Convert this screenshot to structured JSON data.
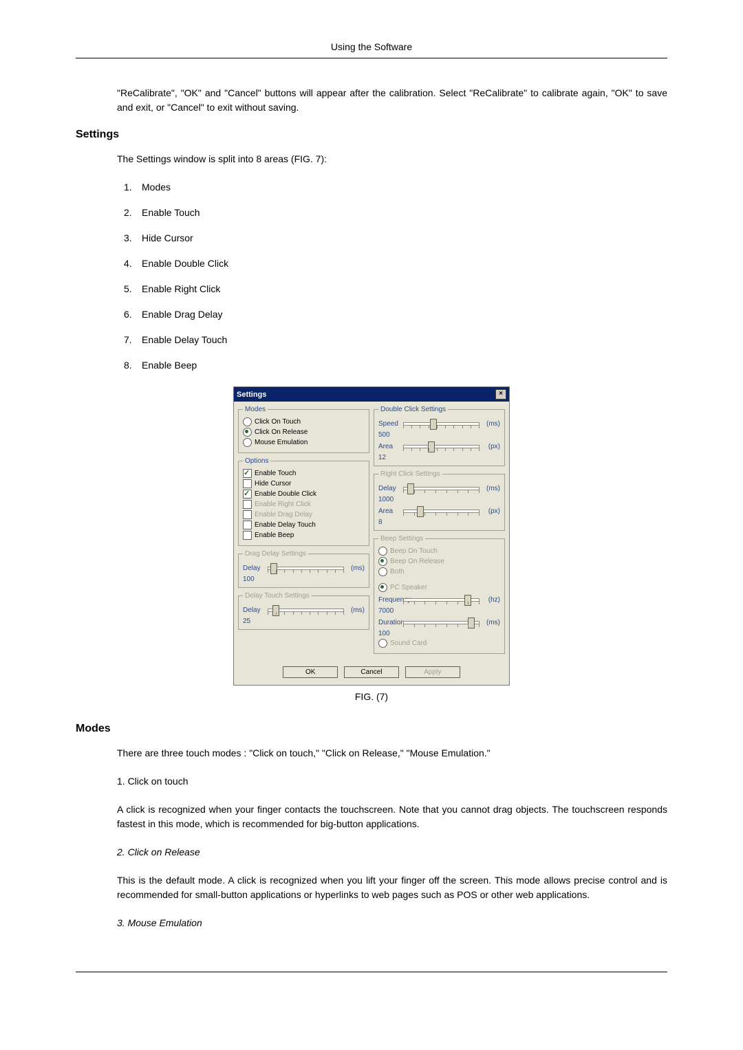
{
  "header": "Using the Software",
  "intro_para": "\"ReCalibrate\", \"OK\" and \"Cancel\" buttons will appear after the calibration. Select \"ReCalibrate\" to calibrate again, \"OK\" to save and exit, or \"Cancel\" to exit without saving.",
  "settings_heading": "Settings",
  "settings_intro": "The Settings window is split into 8 areas (FIG. 7):",
  "settings_list": [
    "Modes",
    "Enable Touch",
    "Hide Cursor",
    "Enable Double Click",
    "Enable Right Click",
    "Enable Drag Delay",
    "Enable Delay Touch",
    "Enable Beep"
  ],
  "fig_caption": "FIG. (7)",
  "modes_heading": "Modes",
  "modes_intro": "There are three touch modes : \"Click on touch,\" \"Click on Release,\" \"Mouse Emulation.\"",
  "mode1_title": "1. Click on touch",
  "mode1_body": "A click is recognized when your finger contacts the touchscreen. Note that you cannot drag objects. The touchscreen responds fastest in this mode, which is recommended for big-button applications.",
  "mode2_title": "2. Click on Release",
  "mode2_body": "This is the default mode. A click is recognized when you lift your finger off the screen. This mode allows precise control and is recommended for small-button applications or hyperlinks to web pages such as POS or other web applications.",
  "mode3_title": "3. Mouse Emulation",
  "dlg": {
    "title": "Settings",
    "groups": {
      "modes": {
        "legend": "Modes",
        "click_on_touch": "Click On Touch",
        "click_on_release": "Click On Release",
        "mouse_emulation": "Mouse Emulation"
      },
      "options": {
        "legend": "Options",
        "enable_touch": "Enable Touch",
        "hide_cursor": "Hide Cursor",
        "enable_double_click": "Enable Double Click",
        "enable_right_click": "Enable Right Click",
        "enable_drag_delay": "Enable Drag Delay",
        "enable_delay_touch": "Enable Delay Touch",
        "enable_beep": "Enable Beep"
      },
      "drag_delay": {
        "legend": "Drag Delay Settings",
        "delay_label": "Delay",
        "delay_value": "100",
        "unit": "(ms)"
      },
      "delay_touch": {
        "legend": "Delay Touch Settings",
        "delay_label": "Delay",
        "delay_value": "25",
        "unit": "(ms)"
      },
      "double_click": {
        "legend": "Double Click Settings",
        "speed_label": "Speed",
        "speed_value": "500",
        "speed_unit": "(ms)",
        "area_label": "Area",
        "area_value": "12",
        "area_unit": "(px)"
      },
      "right_click": {
        "legend": "Right Click Settings",
        "delay_label": "Delay",
        "delay_value": "1000",
        "delay_unit": "(ms)",
        "area_label": "Area",
        "area_value": "8",
        "area_unit": "(px)"
      },
      "beep": {
        "legend": "Beep Settings",
        "beep_on_touch": "Beep On Touch",
        "beep_on_release": "Beep On Release",
        "both": "Both",
        "pc_speaker": "PC Speaker",
        "freq_label": "Frequency",
        "freq_value": "7000",
        "freq_unit": "(hz)",
        "dur_label": "Duration",
        "dur_value": "100",
        "dur_unit": "(ms)",
        "sound_card": "Sound Card"
      }
    },
    "buttons": {
      "ok": "OK",
      "cancel": "Cancel",
      "apply": "Apply"
    }
  }
}
